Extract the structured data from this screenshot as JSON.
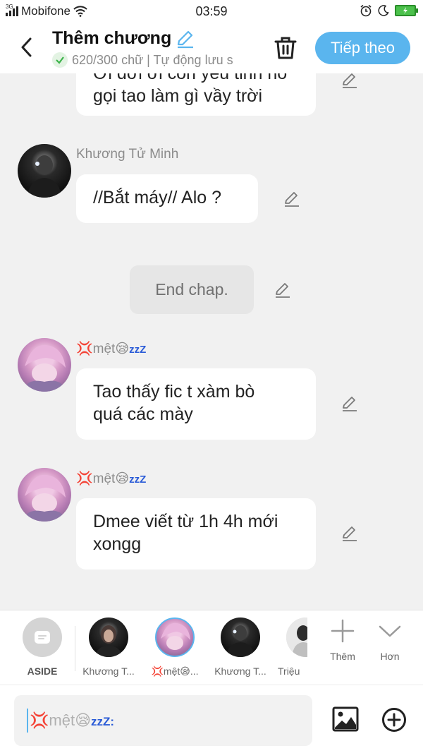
{
  "status_bar": {
    "network": "3G",
    "carrier": "Mobifone",
    "time": "03:59"
  },
  "header": {
    "title": "Thêm chương",
    "subtitle": "620/300 chữ | Tự động lưu s",
    "next_label": "Tiếp theo"
  },
  "messages": [
    {
      "text_line1": "Ơi dơi ơi con yêu tinh nó",
      "text_line2": "gọi tao làm gì vầy trời"
    },
    {
      "sender": "Khương Tử Minh",
      "text": "//Bắt máy// Alo ?"
    },
    {
      "text": "End chap."
    },
    {
      "sender": "💢mệt😪",
      "sender_suffix": "zzZ",
      "text_line1": "Tao thấy fic t xàm bò",
      "text_line2": "quá các mày"
    },
    {
      "sender": "💢mệt😪",
      "sender_suffix": "zzZ",
      "text_line1": "Dmee viết từ 1h 4h mới",
      "text_line2": "xongg"
    }
  ],
  "characters": [
    {
      "label": "ASIDE"
    },
    {
      "label": "Khương T..."
    },
    {
      "label": "💢mệt😪..."
    },
    {
      "label": "Khương T..."
    },
    {
      "label": "Triệu"
    }
  ],
  "bar_actions": {
    "add_label": "Thêm",
    "more_label": "Hơn"
  },
  "input": {
    "placeholder": "💢mệt😪",
    "placeholder_suffix": "zzZ:"
  },
  "colors": {
    "accent": "#5ab5ee",
    "background": "#f1f1f1",
    "bubble": "#ffffff"
  }
}
